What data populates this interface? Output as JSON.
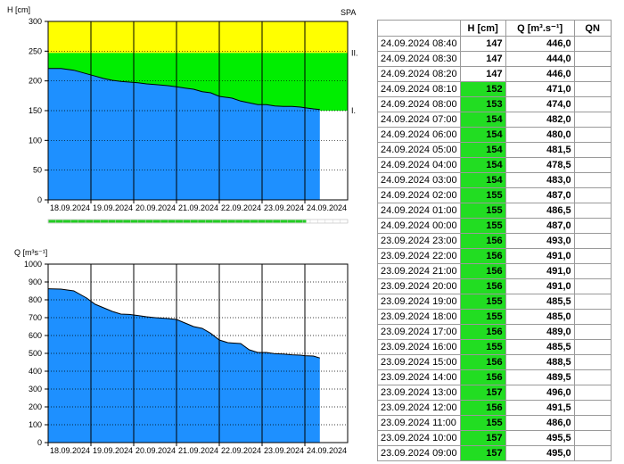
{
  "h_chart": {
    "ylabel": "H [cm]",
    "station": "SPA",
    "yticks": [
      "0",
      "50",
      "100",
      "150",
      "200",
      "250",
      "300"
    ],
    "ylim": [
      0,
      300
    ],
    "flood_levels": [
      {
        "label": "II.",
        "value": 247
      },
      {
        "label": "I.",
        "value": 150
      }
    ],
    "zone_colors": {
      "level2": "#ffff00",
      "level1": "#00ee00",
      "series": "#1e90ff"
    },
    "xticks": [
      "18.09.2024",
      "19.09.2024",
      "20.09.2024",
      "21.09.2024",
      "22.09.2024",
      "23.09.2024",
      "24.09.2024"
    ],
    "data_coverage": 0.86
  },
  "q_chart": {
    "ylabel": "Q [m³s⁻¹]",
    "yticks": [
      "0",
      "100",
      "200",
      "300",
      "400",
      "500",
      "600",
      "700",
      "800",
      "900",
      "1000"
    ],
    "ylim": [
      0,
      1000
    ],
    "series_color": "#1e90ff",
    "xticks": [
      "18.09.2024",
      "19.09.2024",
      "20.09.2024",
      "21.09.2024",
      "22.09.2024",
      "23.09.2024",
      "24.09.2024"
    ]
  },
  "chart_data": [
    {
      "type": "area",
      "ylabel": "H [cm]",
      "ylim": [
        0,
        300
      ],
      "x_days_span": [
        0,
        7
      ],
      "grid": true,
      "x": [
        0.0,
        0.3,
        0.6,
        0.9,
        1.1,
        1.3,
        1.5,
        1.7,
        1.9,
        2.1,
        2.3,
        2.5,
        2.8,
        3.0,
        3.2,
        3.4,
        3.6,
        3.8,
        4.0,
        4.2,
        4.3,
        4.5,
        4.7,
        4.9,
        5.1,
        5.3,
        5.5,
        5.7,
        5.9,
        6.0,
        6.2,
        6.35
      ],
      "values": [
        221,
        221,
        218,
        212,
        208,
        204,
        201,
        199,
        198,
        197,
        195,
        194,
        192,
        190,
        188,
        186,
        182,
        180,
        174,
        172,
        171,
        166,
        163,
        160,
        160,
        158,
        157,
        157,
        156,
        155,
        153,
        152
      ]
    },
    {
      "type": "area",
      "ylabel": "Q [m³s⁻¹]",
      "ylim": [
        0,
        1000
      ],
      "grid": true,
      "x": [
        0.0,
        0.3,
        0.6,
        0.9,
        1.1,
        1.3,
        1.5,
        1.7,
        1.9,
        2.1,
        2.3,
        2.5,
        2.8,
        3.0,
        3.2,
        3.4,
        3.6,
        3.8,
        4.0,
        4.2,
        4.3,
        4.5,
        4.7,
        4.9,
        5.1,
        5.3,
        5.5,
        5.7,
        5.9,
        6.0,
        6.2,
        6.35
      ],
      "values": [
        862,
        860,
        850,
        810,
        775,
        755,
        735,
        720,
        718,
        712,
        705,
        700,
        695,
        690,
        670,
        650,
        640,
        612,
        575,
        560,
        558,
        555,
        520,
        505,
        505,
        498,
        496,
        492,
        490,
        487,
        485,
        474
      ]
    }
  ],
  "table": {
    "headers": [
      "",
      "H [cm]",
      "Q [m³.s⁻¹]",
      "QN"
    ],
    "rows": [
      {
        "dt": "24.09.2024 08:40",
        "h": "147",
        "q": "446,0",
        "green": false
      },
      {
        "dt": "24.09.2024 08:30",
        "h": "147",
        "q": "444,0",
        "green": false
      },
      {
        "dt": "24.09.2024 08:20",
        "h": "147",
        "q": "446,0",
        "green": false
      },
      {
        "dt": "24.09.2024 08:10",
        "h": "152",
        "q": "471,0",
        "green": true
      },
      {
        "dt": "24.09.2024 08:00",
        "h": "153",
        "q": "474,0",
        "green": true
      },
      {
        "dt": "24.09.2024 07:00",
        "h": "154",
        "q": "482,0",
        "green": true
      },
      {
        "dt": "24.09.2024 06:00",
        "h": "154",
        "q": "480,0",
        "green": true
      },
      {
        "dt": "24.09.2024 05:00",
        "h": "154",
        "q": "481,5",
        "green": true
      },
      {
        "dt": "24.09.2024 04:00",
        "h": "154",
        "q": "478,5",
        "green": true
      },
      {
        "dt": "24.09.2024 03:00",
        "h": "154",
        "q": "483,0",
        "green": true
      },
      {
        "dt": "24.09.2024 02:00",
        "h": "155",
        "q": "487,0",
        "green": true
      },
      {
        "dt": "24.09.2024 01:00",
        "h": "155",
        "q": "486,5",
        "green": true
      },
      {
        "dt": "24.09.2024 00:00",
        "h": "155",
        "q": "487,0",
        "green": true
      },
      {
        "dt": "23.09.2024 23:00",
        "h": "156",
        "q": "493,0",
        "green": true
      },
      {
        "dt": "23.09.2024 22:00",
        "h": "156",
        "q": "491,0",
        "green": true
      },
      {
        "dt": "23.09.2024 21:00",
        "h": "156",
        "q": "491,0",
        "green": true
      },
      {
        "dt": "23.09.2024 20:00",
        "h": "156",
        "q": "491,0",
        "green": true
      },
      {
        "dt": "23.09.2024 19:00",
        "h": "155",
        "q": "485,5",
        "green": true
      },
      {
        "dt": "23.09.2024 18:00",
        "h": "155",
        "q": "485,0",
        "green": true
      },
      {
        "dt": "23.09.2024 17:00",
        "h": "156",
        "q": "489,0",
        "green": true
      },
      {
        "dt": "23.09.2024 16:00",
        "h": "155",
        "q": "485,5",
        "green": true
      },
      {
        "dt": "23.09.2024 15:00",
        "h": "156",
        "q": "488,5",
        "green": true
      },
      {
        "dt": "23.09.2024 14:00",
        "h": "156",
        "q": "489,5",
        "green": true
      },
      {
        "dt": "23.09.2024 13:00",
        "h": "157",
        "q": "496,0",
        "green": true
      },
      {
        "dt": "23.09.2024 12:00",
        "h": "156",
        "q": "491,5",
        "green": true
      },
      {
        "dt": "23.09.2024 11:00",
        "h": "155",
        "q": "486,0",
        "green": true
      },
      {
        "dt": "23.09.2024 10:00",
        "h": "157",
        "q": "495,5",
        "green": true
      },
      {
        "dt": "23.09.2024 09:00",
        "h": "157",
        "q": "495,0",
        "green": true
      }
    ]
  }
}
